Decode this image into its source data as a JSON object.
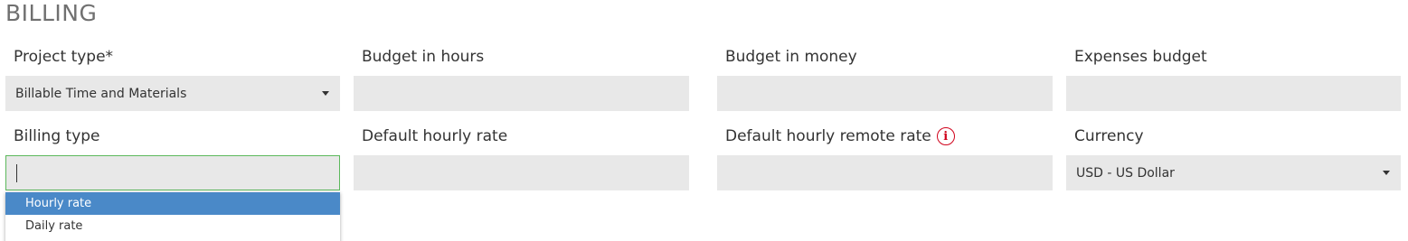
{
  "section": {
    "title": "BILLING"
  },
  "fields": {
    "project_type": {
      "label": "Project type*",
      "value": "Billable Time and Materials"
    },
    "budget_hours": {
      "label": "Budget in hours",
      "value": ""
    },
    "budget_money": {
      "label": "Budget in money",
      "value": ""
    },
    "expenses_budget": {
      "label": "Expenses budget",
      "value": ""
    },
    "billing_type": {
      "label": "Billing type",
      "value": ""
    },
    "default_hourly_rate": {
      "label": "Default hourly rate",
      "value": ""
    },
    "default_remote_rate": {
      "label": "Default hourly remote rate",
      "info_icon": "info-circle-icon",
      "value": ""
    },
    "currency": {
      "label": "Currency",
      "value": "USD - US Dollar"
    }
  },
  "billing_type_dropdown": {
    "options": [
      "Hourly rate",
      "Daily rate"
    ],
    "highlighted_index": 0
  },
  "colors": {
    "field_bg": "#e8e8e8",
    "focus_border": "#5cb85c",
    "highlight": "#4a89c8",
    "info_icon": "#d0021b"
  }
}
